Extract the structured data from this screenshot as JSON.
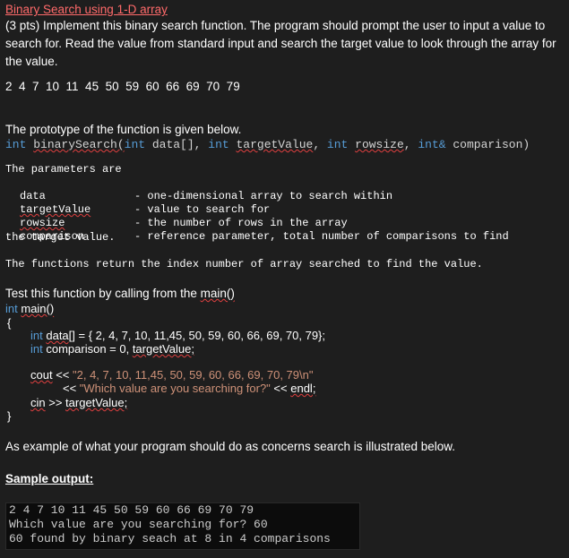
{
  "title": "Binary Search using 1-D array",
  "intro": "(3 pts) Implement this binary search function. The program should prompt the user to input a value to search for. Read the value from standard input and search the target value to look through the array for the value.",
  "array_line": "2  4  7  10  11  45  50  59  60  66  69  70  79",
  "prototype_intro": "The prototype of the function is given below.",
  "prototype": {
    "kw_int": "int",
    "func": "binarySearch(",
    "kw_int2": "int",
    "arg1": " data[], ",
    "kw_int3": "int",
    "arg2": "targetValue",
    "sep2": ", ",
    "kw_int4": "int",
    "arg3": "rowsize",
    "sep3": ", ",
    "kw_int5": "int&",
    "arg4": " comparison)"
  },
  "params": {
    "heading": "The parameters are",
    "rows": [
      {
        "name": "data",
        "desc": "- one-dimensional array to search within"
      },
      {
        "name": "targetValue",
        "desc": "- value to search for"
      },
      {
        "name": "rowsize",
        "desc": "- the number of rows in the array"
      },
      {
        "name": "comparison",
        "desc": "- reference parameter, total number of comparisons to find"
      }
    ],
    "tail": "the target value."
  },
  "returns": "The functions return the index number of array searched to find the value.",
  "test_intro": "Test this function by calling from the ",
  "test_main": "main()",
  "code": {
    "main_kw": "int",
    "main_name": "main()",
    "open_brace": "{",
    "l1_kw": "int",
    "l1_name": "data[]",
    "l1_rest": " = { 2, 4, 7, 10, 11,45, 50, 59, 60, 66, 69, 70, 79};",
    "l2_kw": "int",
    "l2_rest": " comparison = 0, ",
    "l2_target": "targetValue;",
    "l3_cout": "cout",
    "l3_op": " << ",
    "l3_str": "\"2, 4, 7, 10, 11,45, 50, 59, 60, 66, 69, 70, 79\\n\"",
    "l4_op": "<< ",
    "l4_str": "\"Which value are you searching for?\"",
    "l4_op2": " << ",
    "l4_endl": "endl;",
    "l5_cin": "cin",
    "l5_op": " >> ",
    "l5_target": "targetValue;",
    "close_brace": "}"
  },
  "example_text": "As example of what your program should do as concerns search is illustrated below.",
  "sample_heading": "Sample output:",
  "console_lines": [
    "2 4 7 10 11 45 50 59 60 66 69 70 79",
    "Which value are you searching for? 60",
    "60 found by binary seach at 8 in 4 comparisons"
  ]
}
